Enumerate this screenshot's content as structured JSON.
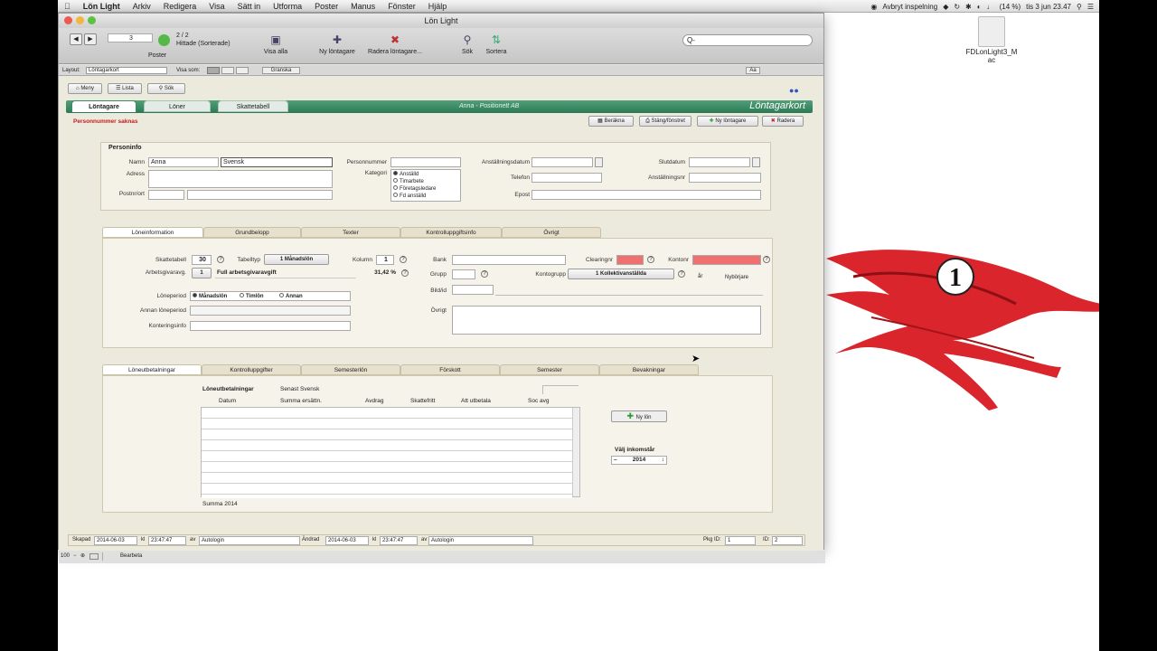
{
  "menubar": {
    "apple": "",
    "items": [
      "Lön Light",
      "Arkiv",
      "Redigera",
      "Visa",
      "Sätt in",
      "Utforma",
      "Poster",
      "Manus",
      "Fönster",
      "Hjälp"
    ],
    "recording": "Avbryt inspelning",
    "battery": "(14 %)",
    "clock": "tis 3 jun  23.47"
  },
  "desktop": {
    "file_label": "FDLonLight3_M",
    "file_label2": "ac"
  },
  "window": {
    "title": "Lön Light",
    "record_value": "3",
    "record_count": "2 / 2",
    "found_label": "Hittade (Sorterade)",
    "poster_label": "Poster",
    "toolbar": {
      "show_all": "Visa alla",
      "new_employee": "Ny löntagare",
      "delete_employee": "Radera löntagare...",
      "search": "Sök",
      "sort": "Sortera"
    },
    "search_placeholder": "Q-",
    "layout_label": "Layout:",
    "layout_value": "Löntagarkort",
    "view_label": "Visa som:",
    "preview_label": "Granska",
    "aa_label": "Aa"
  },
  "nav": {
    "menu": "Meny",
    "list": "Lista",
    "search": "Sök"
  },
  "main_tabs": [
    "Löntagare",
    "Löner",
    "Skattetabell"
  ],
  "header": {
    "employee_name": "Anna  - Positionett AB",
    "card_title": "Löntagarkort"
  },
  "warning": "Personnummer saknas",
  "actions": {
    "calc": "Beräkna",
    "save_close": "Stäng/fönstret",
    "new_employee": "Ny löntagare",
    "delete": "Radera"
  },
  "personinfo": {
    "title": "Personinfo",
    "name_label": "Namn",
    "first_name": "Anna",
    "last_name": "Svensk",
    "address_label": "Adress",
    "postal_label": "Postnr/ort",
    "personnr_label": "Personnummer",
    "category_label": "Kategori",
    "categories": [
      "Anställd",
      "Timarbete",
      "Företagsledare",
      "Fd anställd"
    ],
    "hired_label": "Anställningsdatum",
    "phone_label": "Telefon",
    "email_label": "Epost",
    "end_label": "Slutdatum",
    "empno_label": "Anställningsnr"
  },
  "salary_tabs": [
    "Löneinformation",
    "Grundbelopp",
    "Texter",
    "Kontrolluppgiftsinfo",
    "Övrigt"
  ],
  "salary": {
    "tax_table_label": "Skattetabell",
    "tax_table": "30",
    "table_type_label": "Tabelltyp",
    "table_type": "1 Månadslön",
    "column_label": "Kolumn",
    "column": "1",
    "employer_label": "Arbetsgivaravg.",
    "employer_code": "1",
    "employer_text": "Full arbetsgivaravgift",
    "employer_pct": "31,42 %",
    "period_label": "Löneperiod",
    "periods": [
      "Månadslön",
      "Timlön",
      "Annan"
    ],
    "other_period_label": "Annan löneperiod",
    "account_label": "Konteringsinfo",
    "bank_label": "Bank",
    "clearing_label": "Clearingnr",
    "account_no_label": "Kontonr",
    "group_label": "Grupp",
    "account_group_label": "Kontogrupp",
    "account_group": "1 Kollektivanställda",
    "year_label": "år",
    "standard_label": "Nybörjare",
    "image_label": "Bild/id",
    "other_label": "Övrigt"
  },
  "payment_tabs": [
    "Löneutbetalningar",
    "Kontrolluppgifter",
    "Semesterlön",
    "Förskott",
    "Semester",
    "Bevakningar"
  ],
  "payments": {
    "title": "Löneutbetalningar",
    "subtitle": "Senast Svensk",
    "columns": [
      "Datum",
      "Summa ersättn.",
      "Avdrag",
      "Skattefritt",
      "Att utbetala",
      "Soc avg"
    ],
    "new_label": "Ny lön",
    "year_pick_label": "Välj inkomstår",
    "year": "2014",
    "sum_label": "Summa 2014"
  },
  "status": {
    "created_label": "Skapad",
    "created_date": "2014-06-03",
    "kl1": "kl",
    "created_time": "23:47:47",
    "av1": "av",
    "created_by": "Autologin",
    "changed_label": "Ändrad",
    "changed_date": "2014-06-03",
    "kl2": "kl",
    "changed_time": "23:47:47",
    "av2": "av",
    "changed_by": "Autologin",
    "pkg_label": "Pkg ID:",
    "pkg_value": "1",
    "id_label": "ID:",
    "id_value": "2"
  },
  "footer": {
    "zoom": "100",
    "mode": "Bearbeta"
  },
  "logo": {
    "number": "1"
  }
}
